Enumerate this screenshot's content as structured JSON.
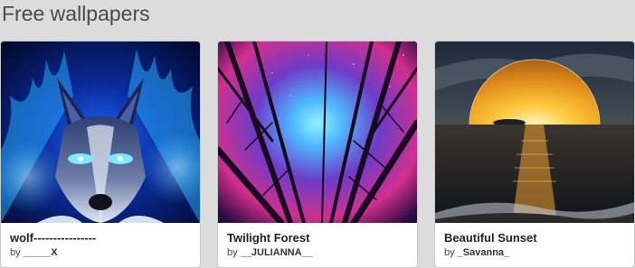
{
  "section": {
    "title": "Free wallpapers"
  },
  "cards": [
    {
      "title": "wolf----------------",
      "by": "by",
      "author": "_____X"
    },
    {
      "title": "Twilight Forest",
      "by": "by",
      "author": "__JULIANNA__"
    },
    {
      "title": "Beautiful Sunset",
      "by": "by",
      "author": "_Savanna_"
    }
  ],
  "colors": {
    "background": "#dcdcdc",
    "card": "#ffffff",
    "title": "#4a4a4a"
  }
}
